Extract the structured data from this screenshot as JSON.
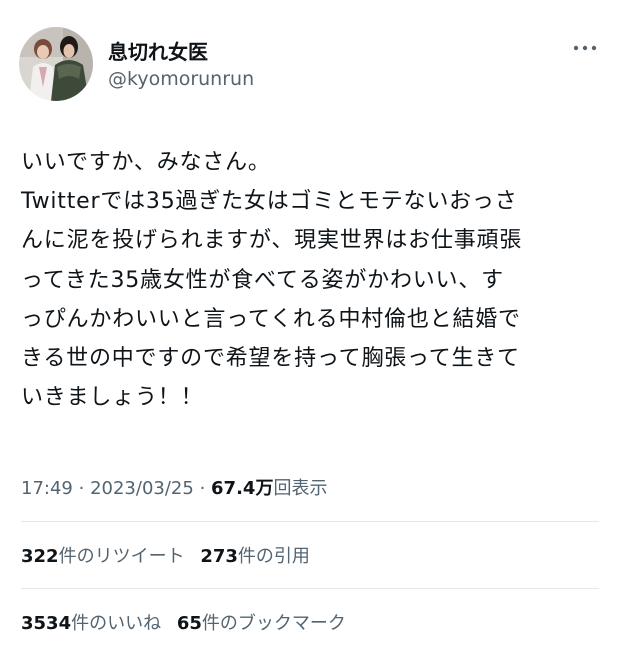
{
  "author": {
    "display_name": "息切れ女医",
    "handle": "@kyomorunrun",
    "avatar": "avatar-photo"
  },
  "more_icon": "more-horizontal-icon",
  "tweet": {
    "lines": [
      "いいですか、みなさん。",
      "Twitterでは35過ぎた女はゴミとモテないおっさ",
      "んに泥を投げられますが、現実世界はお仕事頑張",
      "ってきた35歳女性が食べてる姿がかわいい、す",
      "っぴんかわいいと言ってくれる中村倫也と結婚で",
      "きる世の中ですので希望を持って胸張って生きて",
      "いきましょう！！"
    ]
  },
  "meta": {
    "time": "17:49",
    "separator": "·",
    "date": "2023/03/25",
    "views_count": "67.4万",
    "views_label": "回表示"
  },
  "stats": {
    "retweets": {
      "count": "322",
      "label": "件のリツイート"
    },
    "quotes": {
      "count": "273",
      "label": "件の引用"
    },
    "likes": {
      "count": "3534",
      "label": "件のいいね"
    },
    "bookmarks": {
      "count": "65",
      "label": "件のブックマーク"
    }
  },
  "colors": {
    "text_primary": "#0f1419",
    "text_secondary": "#536471",
    "divider": "#e4e8eb",
    "background": "#ffffff"
  }
}
